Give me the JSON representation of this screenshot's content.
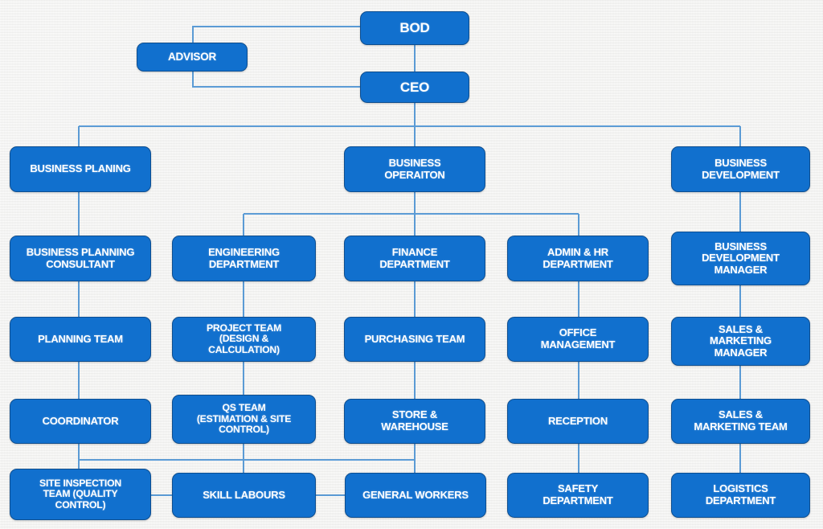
{
  "diagram": {
    "title": "Organizational Structure Chart",
    "type": "org-chart",
    "colors": {
      "node_fill": "#1170CE",
      "node_border": "#0E4E8F",
      "node_text": "#FFFFFF",
      "connector": "#5B9BD5",
      "background": "#F7F7F5"
    }
  },
  "nodes": {
    "bod": "BOD",
    "advisor": "ADVISOR",
    "ceo": "CEO",
    "business_planing": "BUSINESS PLANING",
    "business_operaiton": "BUSINESS\nOPERAITON",
    "business_development": "BUSINESS\nDEVELOPMENT",
    "business_planning_consultant": "BUSINESS PLANNING\nCONSULTANT",
    "engineering_department": "ENGINEERING\nDEPARTMENT",
    "finance_department": "FINANCE\nDEPARTMENT",
    "admin_hr_department": "ADMIN & HR\nDEPARTMENT",
    "business_development_manager": "BUSINESS\nDEVELOPMENT\nMANAGER",
    "planning_team": "PLANNING TEAM",
    "project_team": "PROJECT TEAM\n(DESIGN &\nCALCULATION)",
    "purchasing_team": "PURCHASING TEAM",
    "office_management": "OFFICE\nMANAGEMENT",
    "sales_marketing_manager": "SALES &\nMARKETING\nMANAGER",
    "coordinator": "COORDINATOR",
    "qs_team": "QS TEAM\n(ESTIMATION & SITE\nCONTROL)",
    "store_warehouse": "STORE &\nWAREHOUSE",
    "reception": "RECEPTION",
    "sales_marketing_team": "SALES &\nMARKETING TEAM",
    "site_inspection_team": "SITE INSPECTION\nTEAM (QUALITY\nCONTROL)",
    "skill_labours": "SKILL LABOURS",
    "general_workers": "GENERAL WORKERS",
    "safety_department": "SAFETY\nDEPARTMENT",
    "logistics_department": "LOGISTICS\nDEPARTMENT"
  },
  "hierarchy": {
    "root": "BOD",
    "levels": [
      [
        "BOD"
      ],
      [
        "ADVISOR",
        "CEO"
      ],
      [
        "BUSINESS PLANING",
        "BUSINESS OPERAITON",
        "BUSINESS DEVELOPMENT"
      ],
      [
        "BUSINESS PLANNING CONSULTANT",
        "ENGINEERING DEPARTMENT",
        "FINANCE DEPARTMENT",
        "ADMIN & HR DEPARTMENT",
        "BUSINESS DEVELOPMENT MANAGER"
      ],
      [
        "PLANNING TEAM",
        "PROJECT TEAM (DESIGN & CALCULATION)",
        "PURCHASING TEAM",
        "OFFICE MANAGEMENT",
        "SALES & MARKETING MANAGER"
      ],
      [
        "COORDINATOR",
        "QS TEAM (ESTIMATION & SITE CONTROL)",
        "STORE & WAREHOUSE",
        "RECEPTION",
        "SALES & MARKETING TEAM"
      ],
      [
        "SITE INSPECTION TEAM (QUALITY CONTROL)",
        "SKILL LABOURS",
        "GENERAL WORKERS",
        "SAFETY DEPARTMENT",
        "LOGISTICS DEPARTMENT"
      ]
    ]
  }
}
